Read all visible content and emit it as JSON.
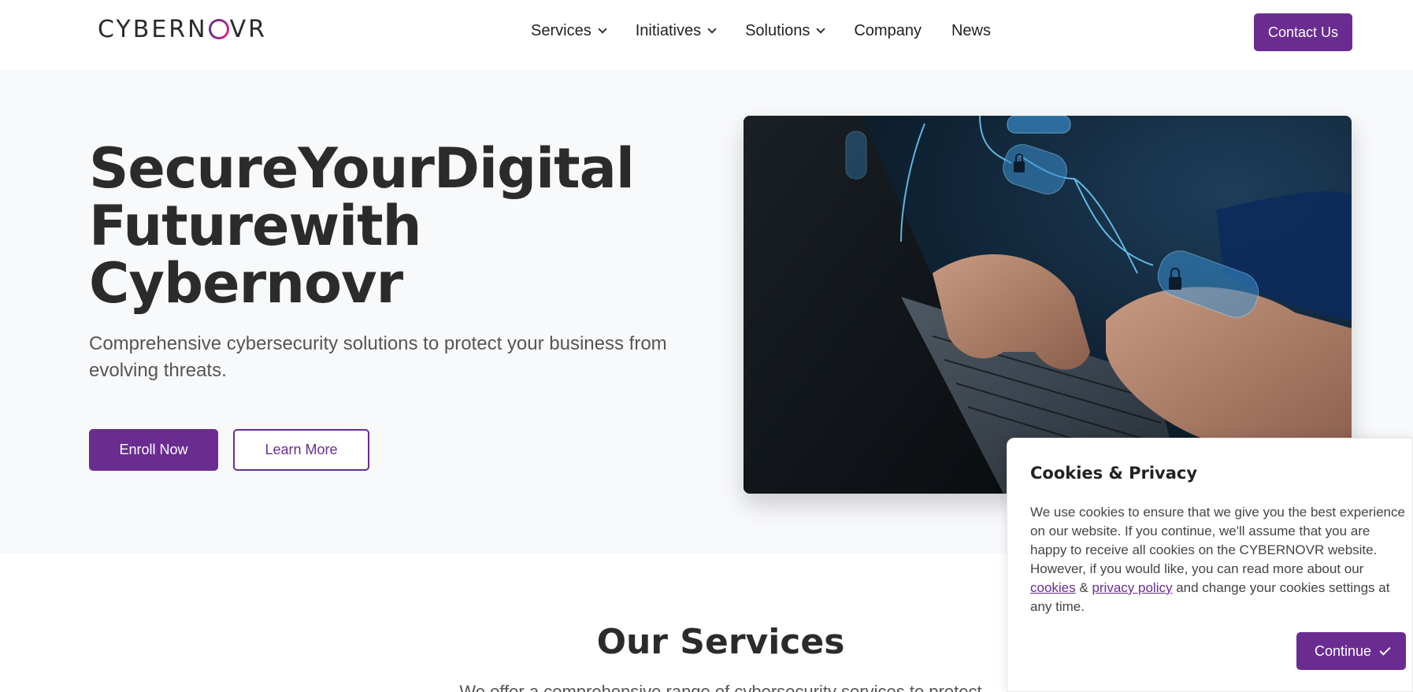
{
  "header": {
    "logo_text": "CYBERNOVR",
    "nav": [
      {
        "label": "Services",
        "has_dropdown": true
      },
      {
        "label": "Initiatives",
        "has_dropdown": true
      },
      {
        "label": "Solutions",
        "has_dropdown": true
      },
      {
        "label": "Company",
        "has_dropdown": false
      },
      {
        "label": "News",
        "has_dropdown": false
      }
    ],
    "contact_label": "Contact Us"
  },
  "hero": {
    "title_line1": "SecureYourDigital",
    "title_line2": "Futurewith",
    "title_line3": "Cybernovr",
    "subtitle": "Comprehensive cybersecurity solutions to protect your business from evolving threats.",
    "enroll_label": "Enroll Now",
    "learn_label": "Learn More"
  },
  "services": {
    "title": "Our Services",
    "subtitle": "We offer a comprehensive range of cybersecurity services to protect"
  },
  "cookie": {
    "title": "Cookies & Privacy",
    "text_before": "We use cookies to ensure that we give you the best experience on our website. If you continue, we'll assume that you are happy to receive all cookies on the CYBERNOVR website. However, if you would like, you can read more about our ",
    "cookies_link": "cookies",
    "amp": " & ",
    "privacy_link": "privacy policy",
    "text_after": " and change your cookies settings at any time.",
    "continue_label": "Continue"
  },
  "colors": {
    "brand": "#6a2c91",
    "hero_bg": "#f8f9fb",
    "text_dark": "#2b2b2b"
  },
  "icons": {
    "dropdown": "chevron-down-icon",
    "continue": "check-icon",
    "image_lock": "lock-icon"
  }
}
